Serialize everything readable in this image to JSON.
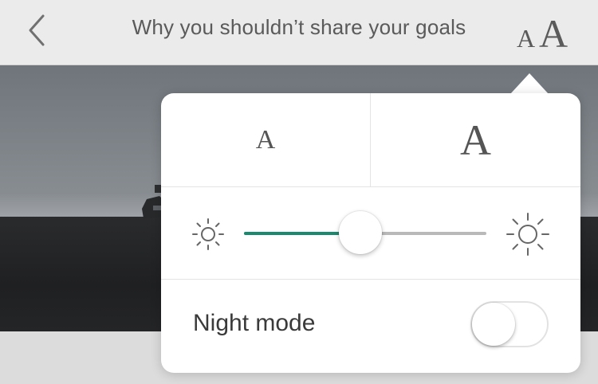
{
  "header": {
    "title": "Why you shouldn’t share your goals",
    "back_icon": "chevron-left-icon",
    "text_size_button": {
      "small_glyph": "A",
      "large_glyph": "A"
    }
  },
  "reader_settings": {
    "font_size": {
      "decrease_label": "A",
      "increase_label": "A"
    },
    "brightness": {
      "min_icon": "sun-small-icon",
      "max_icon": "sun-large-icon",
      "level": 0.48,
      "accent_color": "#1a8a6e"
    },
    "night_mode": {
      "label": "Night mode",
      "enabled": false
    }
  }
}
